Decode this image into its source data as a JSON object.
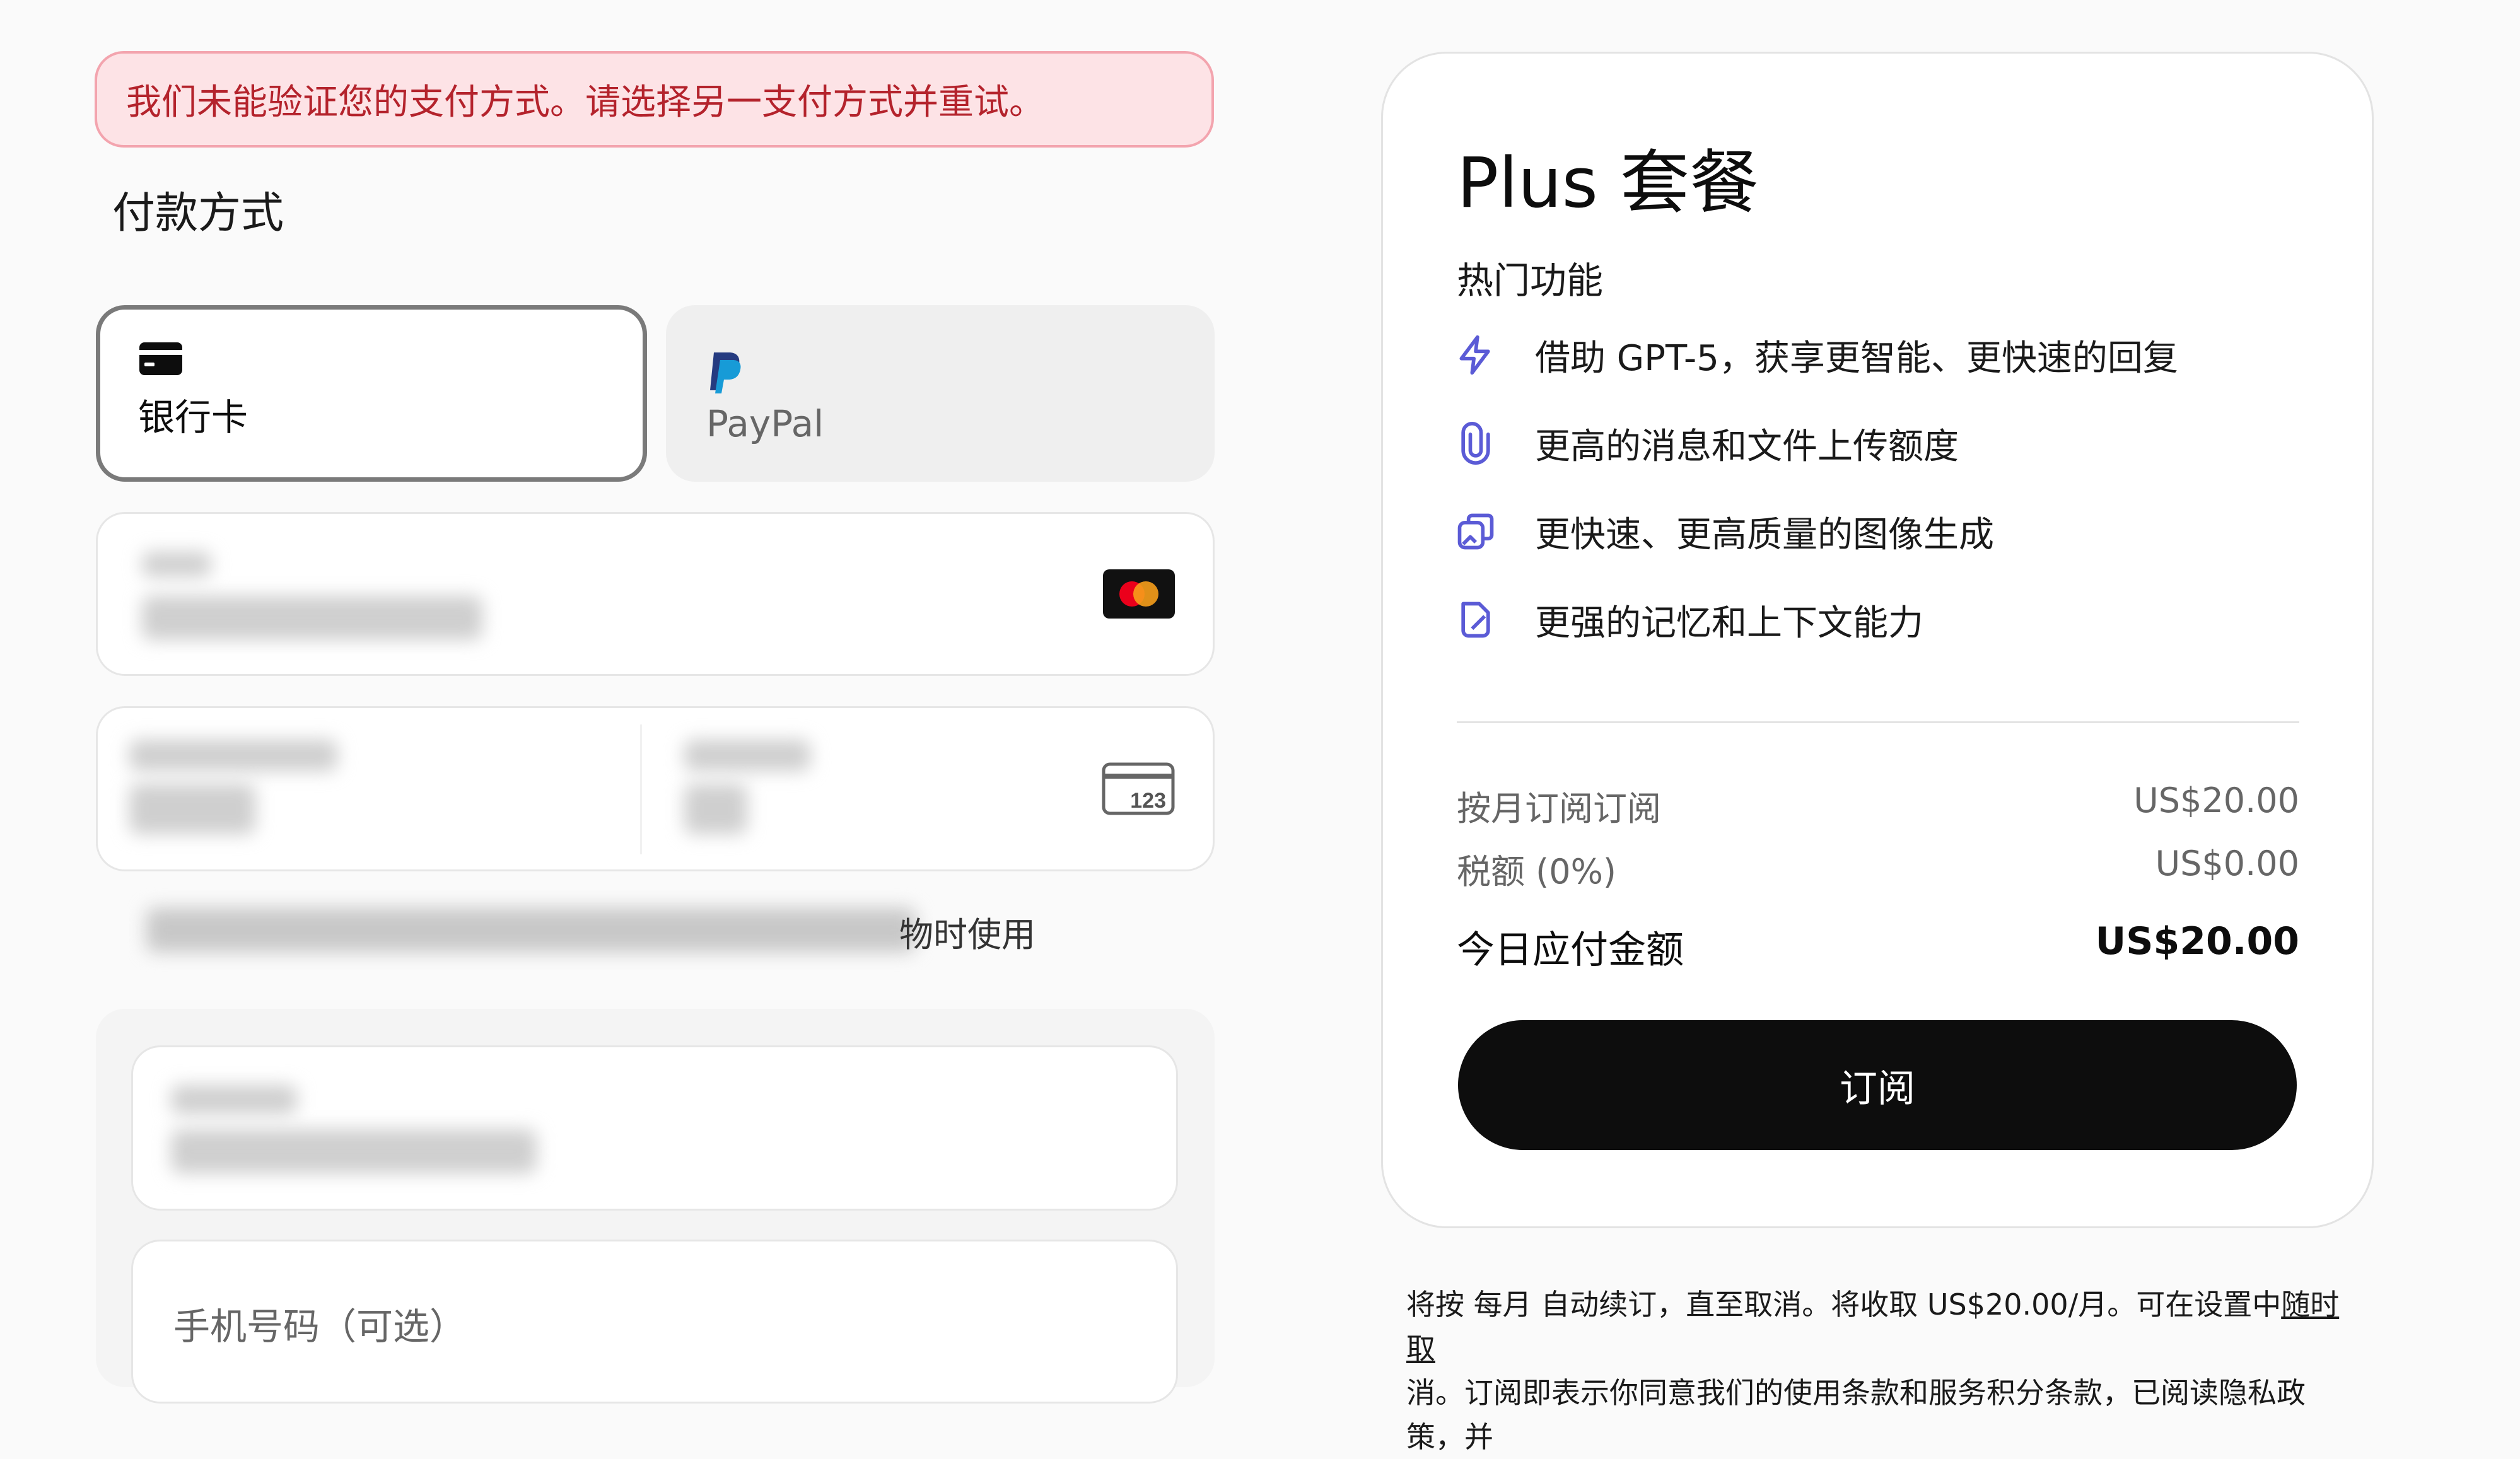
{
  "error": {
    "message": "我们未能验证您的支付方式。请选择另一支付方式并重试。"
  },
  "payment": {
    "title": "付款方式",
    "tabs": [
      {
        "label": "银行卡",
        "icon": "credit-card-icon",
        "selected": true
      },
      {
        "label": "PayPal",
        "icon": "paypal-icon",
        "selected": false
      }
    ],
    "card_brand_icon": "mastercard-icon",
    "cvc_icon_text": "123",
    "save_text_visible": "物时使用",
    "phone_label": "手机号码（可选）"
  },
  "plan": {
    "title": "Plus 套餐",
    "features_label": "热门功能",
    "features": [
      {
        "icon": "lightning-icon",
        "text": "借助 GPT-5，获享更智能、更快速的回复"
      },
      {
        "icon": "paperclip-icon",
        "text": "更高的消息和文件上传额度"
      },
      {
        "icon": "image-gen-icon",
        "text": "更快速、更高质量的图像生成"
      },
      {
        "icon": "memory-icon",
        "text": "更强的记忆和上下文能力"
      }
    ],
    "lines": [
      {
        "label": "按月订阅订阅",
        "amount": "US$20.00"
      },
      {
        "label": "税额 (0%)",
        "amount": "US$0.00"
      }
    ],
    "total": {
      "label": "今日应付金额",
      "amount": "US$20.00"
    },
    "subscribe_label": "订阅",
    "footnote_main": "将按 每月 自动续订，直至取消。将收取 US$20.00/月。可在设置中",
    "footnote_link": "随时取",
    "footnote_line2": "消。订阅即表示你同意我们的使用条款和服务积分条款，已阅读隐私政策，并"
  },
  "colors": {
    "error_bg": "#fde3e6",
    "error_text": "#b4232c",
    "accent_icon": "#5b5bd6",
    "button_bg": "#0d0d0d"
  }
}
